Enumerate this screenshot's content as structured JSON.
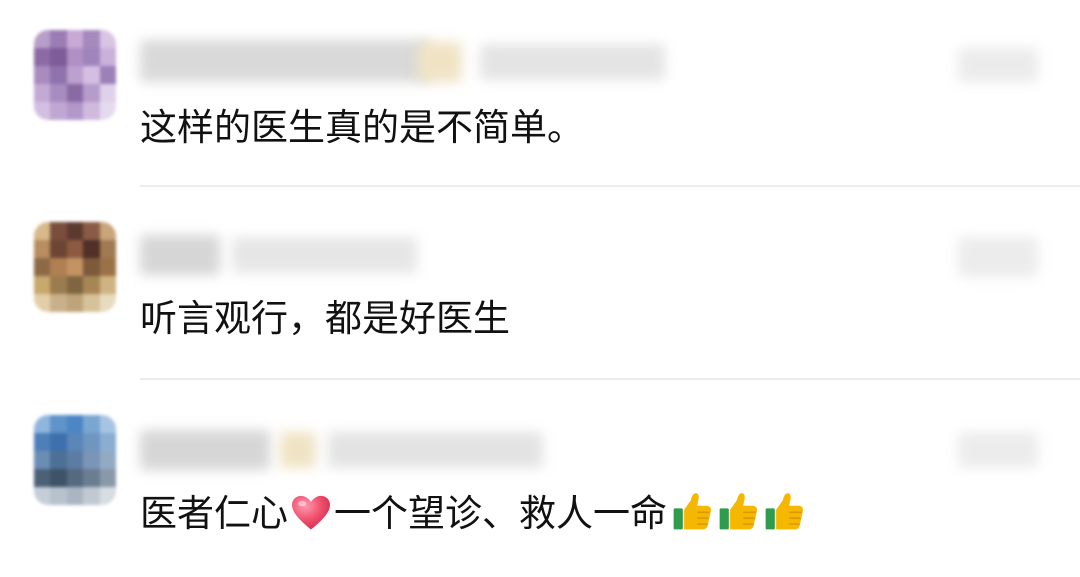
{
  "comments": [
    {
      "text": "这样的医生真的是不简单。",
      "avatar_colors": [
        "#b79fc9",
        "#9b7cb4",
        "#c8a9d6",
        "#a689bd",
        "#d9c4e4",
        "#8d6aa6",
        "#7e5b99",
        "#b08fc5",
        "#9e84bb",
        "#c9b1da",
        "#a98bbf",
        "#8f72ad",
        "#bca0cf",
        "#d4bfe2",
        "#9c80b8",
        "#c3aad4",
        "#a68cc0",
        "#8a6aa3",
        "#b59cca",
        "#e0d1ea",
        "#d2bfe1",
        "#c0a7d3",
        "#b298c9",
        "#cfbade",
        "#e6daee"
      ]
    },
    {
      "text": "听言观行，都是好医生",
      "avatar_colors": [
        "#d8b98a",
        "#7a4e3c",
        "#5c3a30",
        "#8a5b44",
        "#c9a57a",
        "#b88d5f",
        "#6d4534",
        "#8c5a40",
        "#4f2f28",
        "#a07a52",
        "#8d6a45",
        "#b07f52",
        "#c49363",
        "#7e5a3a",
        "#9a7248",
        "#c8a86c",
        "#9b7c4e",
        "#7f6640",
        "#a78655",
        "#d0b383",
        "#e2cfa8",
        "#c9b08a",
        "#bfa37a",
        "#d6c29a",
        "#e8dcc0"
      ]
    },
    {
      "parts_before": "医者仁心",
      "parts_after": "一个望诊、救人一命",
      "avatar_colors": [
        "#8fb7de",
        "#5f93c9",
        "#4d86c5",
        "#7aa6d2",
        "#a6c5e3",
        "#4f7fb8",
        "#3d70ad",
        "#5b86b8",
        "#6f95c1",
        "#8aaed0",
        "#6a8db4",
        "#4e6f96",
        "#5d7ca3",
        "#7b95b6",
        "#93a9c4",
        "#4c6178",
        "#3f5368",
        "#55697f",
        "#6b7d91",
        "#8a99a9",
        "#c5ced8",
        "#b7c2cd",
        "#a9b5c2",
        "#c0c9d2",
        "#d6dde3"
      ]
    }
  ],
  "icons": {
    "heart": "red-heart-icon",
    "thumb": "thumbs-up-icon",
    "thumb_count": 3
  },
  "colors": {
    "text": "#111111",
    "divider": "#ececec",
    "heart": "#f0506e",
    "thumb_yellow": "#f5b700",
    "thumb_green": "#2e9b4e"
  }
}
